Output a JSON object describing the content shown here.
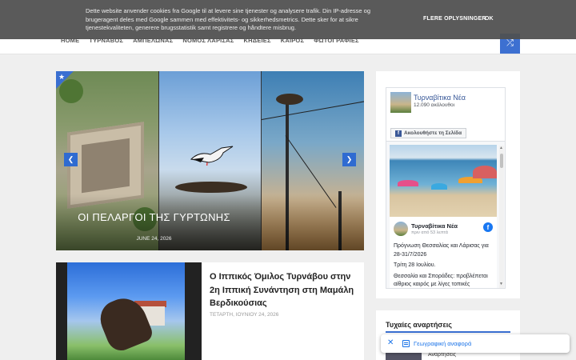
{
  "cookie_bar": {
    "text": "Dette website anvender cookies fra Google til at levere sine tjenester og analysere trafik. Din IP-adresse og brugeragent deles med Google sammen med effektivitets- og sikkerhedsmetrics. Dette sker for at sikre tjenestekvaliteten, generere brugsstatistik samt registrere og håndtere misbrug.",
    "more_info_label": "FLERE OPLYSNINGER",
    "ok_label": "OK"
  },
  "nav": {
    "items": [
      "HOME",
      "ΤΥΡΝΑΒΟΣ",
      "ΑΜΠΕΛΩΝΑΣ",
      "ΝΟΜΟΣ ΛΑΡΙΣΑΣ",
      "ΚΗΔΕΙΕΣ",
      "ΚΑΙΡΟΣ",
      "ΦΩΤΟΓΡΑΦΙΕΣ"
    ],
    "shuffle_icon": "shuffle-icon"
  },
  "slider": {
    "title": "ΟΙ ΠΕΛΑΡΓΟΙ ΤΗΣ ΓΥΡΤΩΝΗΣ",
    "date": "JUNE 24, 2026",
    "prev_icon": "chevron-left-icon",
    "next_icon": "chevron-right-icon",
    "badge_icon": "star-icon"
  },
  "post": {
    "title": "Ο Ιππικός Όμιλος Τυρνάβου στην 2η Ιππική Συνάντηση στη Μαμάλη Βερδικούσιας",
    "date": "ΤΕΤΑΡΤΗ, ΙΟΥΝΙΟΥ 24, 2026"
  },
  "facebook_widget": {
    "page_name": "Τυρναβίτικα Νέα",
    "followers": "12.090 ακόλουθοι",
    "follow_label": "Ακολουθήστε τη Σελίδα",
    "post_author": "Τυρναβίτικα Νέα",
    "post_time": "πριν από 53 λεπτά",
    "post_text": [
      "Πρόγνωση Θεσσαλίας και Λάρισας για 28-31/7/2026",
      "Τρίτη 28 Ιουλίου.",
      "Θεσσαλία και Σποράδες: προβλέπεται αίθριος καιρός με λίγες τοπικές νεφώσεις στα"
    ]
  },
  "random_posts": {
    "title": "Τυχαίες αναρτήσεις",
    "item_text": "Αναρτήσεις"
  },
  "geo_pill": {
    "label": "Γεωγραφική αναφορά",
    "close_icon": "close-icon",
    "map_icon": "map-icon"
  },
  "colors": {
    "accent": "#3d70d1",
    "cookie_bg": "#505050",
    "facebook_blue": "#1877f2"
  }
}
